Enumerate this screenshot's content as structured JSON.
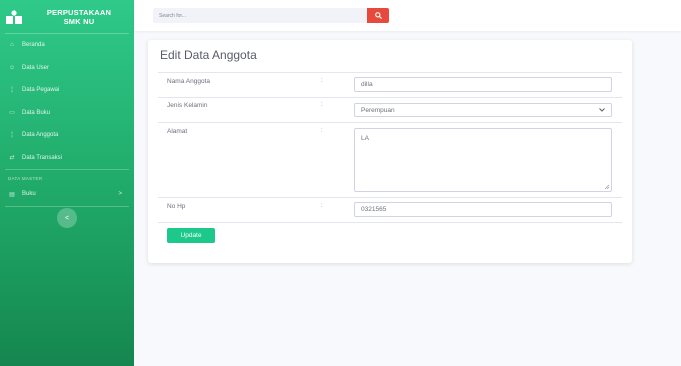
{
  "brand": {
    "line1": "PERPUSTAKAAN",
    "line2": "SMK NU"
  },
  "sidebar": {
    "items": [
      {
        "label": "Beranda",
        "icon": "dashboard-icon"
      },
      {
        "label": "Data User",
        "icon": "user-icon"
      },
      {
        "label": "Data Pegawai",
        "icon": "employee-icon"
      },
      {
        "label": "Data Buku",
        "icon": "book-icon"
      },
      {
        "label": "Data Anggota",
        "icon": "member-icon"
      },
      {
        "label": "Data Transaksi",
        "icon": "transaction-icon"
      }
    ],
    "heading": "DATA MASTER",
    "master_item": {
      "label": "Buku",
      "icon": "folder-icon",
      "arrow": ">"
    },
    "toggle_label": "<"
  },
  "topbar": {
    "search_placeholder": "Search for..."
  },
  "form": {
    "title": "Edit Data Anggota",
    "colon": ":",
    "fields": {
      "nama": {
        "label": "Nama Anggota",
        "value": "dilla"
      },
      "jenis_kelamin": {
        "label": "Jenis Kelamin",
        "value": "Perempuan"
      },
      "alamat": {
        "label": "Alamat",
        "value": "LA"
      },
      "no_hp": {
        "label": "No Hp",
        "value": "0321565"
      }
    },
    "submit_label": "Update"
  },
  "colors": {
    "sidebar_top": "#2fc989",
    "sidebar_bottom": "#15864f",
    "search_button": "#e74a3b",
    "update_button": "#1cc88a"
  }
}
